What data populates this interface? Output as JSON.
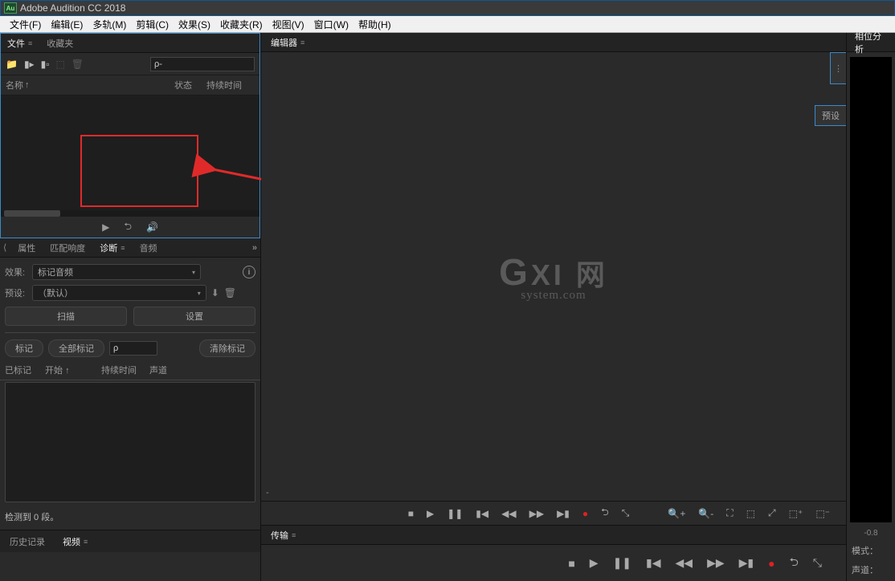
{
  "titlebar": {
    "logo": "Au",
    "title": "Adobe Audition CC 2018"
  },
  "menu": {
    "file": "文件(F)",
    "edit": "编辑(E)",
    "multi": "多轨(M)",
    "clip": "剪辑(C)",
    "effects": "效果(S)",
    "favorites": "收藏夹(R)",
    "view": "视图(V)",
    "window": "窗口(W)",
    "help": "帮助(H)"
  },
  "files": {
    "tab_file": "文件",
    "tab_fav": "收藏夹",
    "col_name": "名称",
    "col_status": "状态",
    "col_duration": "持续时间"
  },
  "diag": {
    "tab_props": "属性",
    "tab_loudness": "匹配响度",
    "tab_diag": "诊断",
    "tab_audio": "音频",
    "label_effect": "效果:",
    "effect_value": "标记音频",
    "label_preset": "预设:",
    "preset_value": "（默认）",
    "btn_scan": "扫描",
    "btn_settings": "设置",
    "btn_mark": "标记",
    "btn_mark_all": "全部标记",
    "btn_clear": "清除标记",
    "col_marked": "已标记",
    "col_start": "开始",
    "col_duration": "持续时间",
    "col_channel": "声道",
    "status": "检测到 0 段。"
  },
  "bottom": {
    "tab_history": "历史记录",
    "tab_video": "视频"
  },
  "editor": {
    "tab": "编辑器",
    "preset": "预设",
    "watermark_l1_big": "G",
    "watermark_l1_rest": "XI 网",
    "watermark_l2": "system.com",
    "minus": "-"
  },
  "transport": {
    "tab": "传输"
  },
  "right": {
    "tab_phase": "相位分析",
    "scale": "-0.8",
    "mode": "模式：",
    "channel": "声道："
  }
}
